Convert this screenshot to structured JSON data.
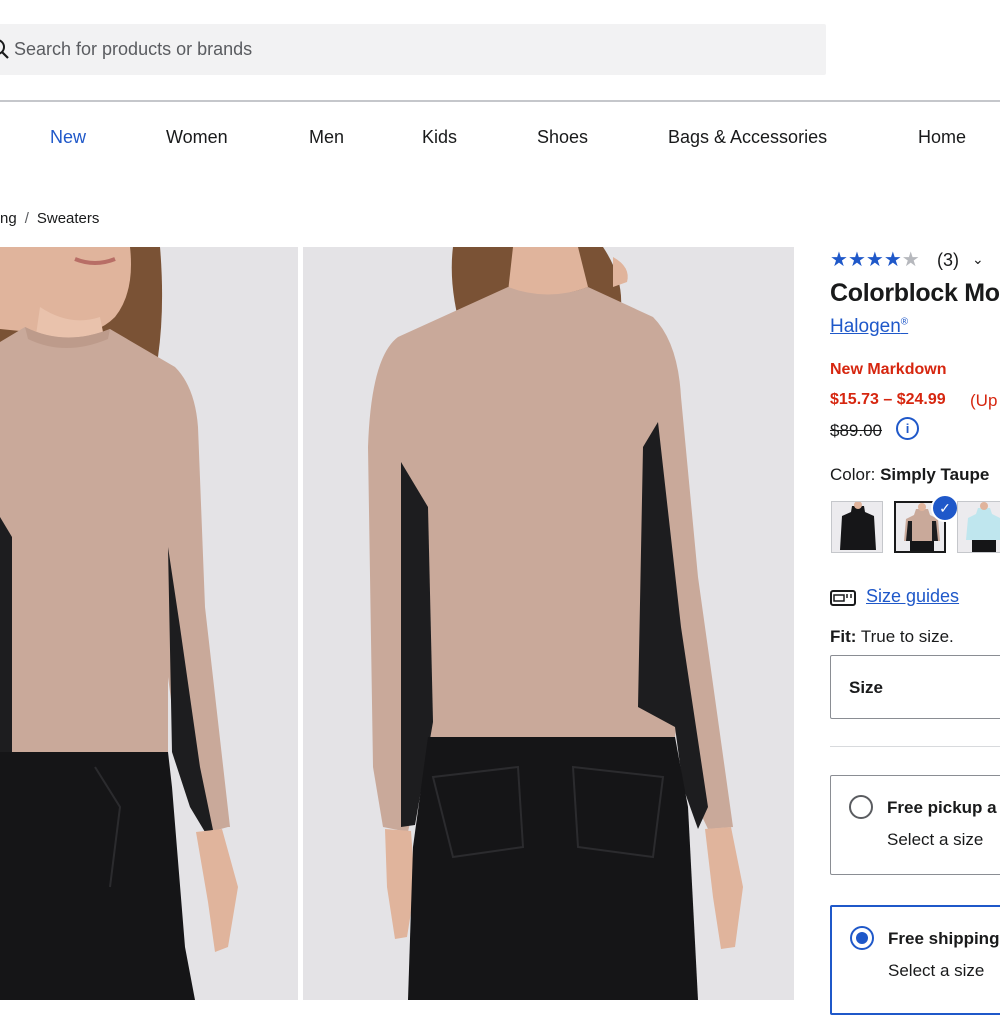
{
  "search": {
    "placeholder": "Search for products or brands"
  },
  "nav": {
    "items": [
      "New",
      "Women",
      "Men",
      "Kids",
      "Shoes",
      "Bags & Accessories",
      "Home"
    ],
    "active": "New"
  },
  "breadcrumb": {
    "items": [
      "ng",
      "Sweaters"
    ],
    "separator": "/"
  },
  "product": {
    "rating": 4,
    "rating_max": 5,
    "review_count": "(3)",
    "title": "Colorblock Mo",
    "brand": "Halogen",
    "brand_mark": "®",
    "badge": "New Markdown",
    "price_range": "$15.73 – $24.99",
    "savings": "(Up",
    "original_price": "$89.00",
    "info_glyph": "i",
    "color_label": "Color:",
    "color_value": "Simply Taupe",
    "swatches": [
      {
        "name": "black",
        "selected": false
      },
      {
        "name": "simply taupe",
        "selected": true
      },
      {
        "name": "light blue",
        "selected": false
      }
    ],
    "size_guides": "Size guides",
    "fit_label": "Fit:",
    "fit_value": "True to size.",
    "size_label": "Size"
  },
  "fulfillment": [
    {
      "title": "Free pickup a",
      "subtitle": "Select a size",
      "selected": false
    },
    {
      "title": "Free shipping",
      "subtitle": "Select a size",
      "selected": true
    }
  ],
  "colors": {
    "accent": "#1f58c9",
    "sale": "#d6260f",
    "text": "#191a1b"
  }
}
